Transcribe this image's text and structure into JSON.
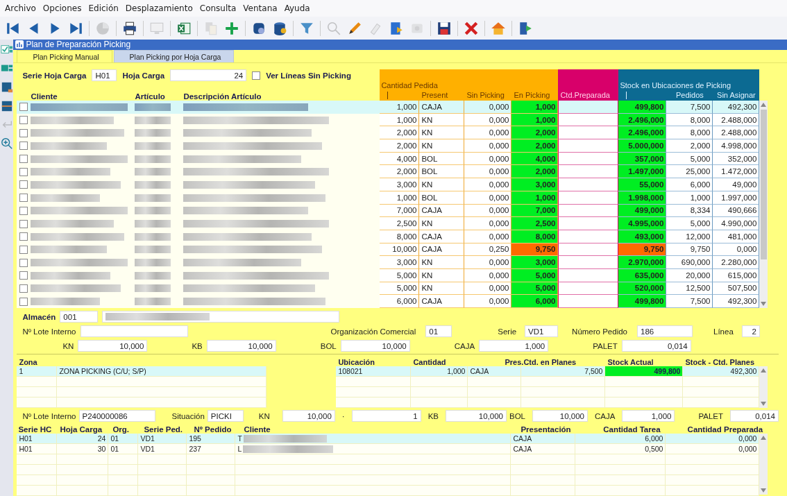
{
  "menu": [
    "Archivo",
    "Opciones",
    "Edición",
    "Desplazamiento",
    "Consulta",
    "Ventana",
    "Ayuda"
  ],
  "toolbar": [
    {
      "kind": "first",
      "disabled": false
    },
    {
      "kind": "prev",
      "disabled": false
    },
    {
      "kind": "next",
      "disabled": false
    },
    {
      "kind": "last",
      "disabled": false
    },
    {
      "kind": "separator"
    },
    {
      "kind": "chart",
      "disabled": true
    },
    {
      "kind": "separator"
    },
    {
      "kind": "print",
      "disabled": false
    },
    {
      "kind": "separator"
    },
    {
      "kind": "monitor",
      "disabled": true
    },
    {
      "kind": "separator"
    },
    {
      "kind": "excel",
      "disabled": false
    },
    {
      "kind": "separator"
    },
    {
      "kind": "copy",
      "disabled": true
    },
    {
      "kind": "add",
      "disabled": false
    },
    {
      "kind": "separator"
    },
    {
      "kind": "database",
      "disabled": false
    },
    {
      "kind": "database-coin",
      "disabled": false
    },
    {
      "kind": "separator"
    },
    {
      "kind": "filter",
      "disabled": false
    },
    {
      "kind": "separator"
    },
    {
      "kind": "search",
      "disabled": true
    },
    {
      "kind": "pencil",
      "disabled": false
    },
    {
      "kind": "eraser",
      "disabled": true
    },
    {
      "kind": "export",
      "disabled": false
    },
    {
      "kind": "help",
      "disabled": true
    },
    {
      "kind": "separator"
    },
    {
      "kind": "save",
      "disabled": false
    },
    {
      "kind": "separator"
    },
    {
      "kind": "delete",
      "disabled": false
    },
    {
      "kind": "separator"
    },
    {
      "kind": "home",
      "disabled": false
    },
    {
      "kind": "separator"
    },
    {
      "kind": "exit",
      "disabled": false
    }
  ],
  "sidebar": [
    {
      "kind": "check",
      "disabled": false
    },
    {
      "kind": "grid",
      "disabled": false
    },
    {
      "kind": "table",
      "disabled": false
    },
    {
      "kind": "rows",
      "disabled": false
    },
    {
      "kind": "return",
      "disabled": true
    },
    {
      "kind": "zoom",
      "disabled": false
    }
  ],
  "window": {
    "title": "Plan de Preparación Picking"
  },
  "tabs": [
    {
      "label": "Plan Picking Manual",
      "selected": true
    },
    {
      "label": "Plan Picking por Hoja Carga",
      "selected": false
    }
  ],
  "filters": {
    "serie_label": "Serie Hoja Carga",
    "serie": "H01",
    "hoja_label": "Hoja Carga",
    "hoja": "24",
    "ver_lineas": {
      "label": "Ver Líneas Sin Picking",
      "checked": false
    }
  },
  "table": {
    "left_columns": [
      "Cliente",
      "Artículo",
      "Descripción Artículo"
    ],
    "group_pedida": "Cantidad Pedida",
    "group_stock": "Stock en Ubicaciones de Picking",
    "columns": [
      "Present",
      "Sin Picking",
      "En Picking",
      "Ctd.Preparada",
      "Pedidos",
      "Sin Asignar"
    ],
    "rows": [
      {
        "selected": true,
        "checked": false,
        "color": "#00ee22",
        "cantidad": "1,000",
        "present": "CAJA",
        "sin_picking": "0,000",
        "en_picking": "1,000",
        "stock": "499,800",
        "pedidos": "7,500",
        "sin_asignar": "492,300"
      },
      {
        "selected": false,
        "checked": false,
        "color": "#00ee22",
        "cantidad": "1,000",
        "present": "KN",
        "sin_picking": "0,000",
        "en_picking": "1,000",
        "stock": "2.496,000",
        "pedidos": "8,000",
        "sin_asignar": "2.488,000"
      },
      {
        "selected": false,
        "checked": false,
        "color": "#00ee22",
        "cantidad": "2,000",
        "present": "KN",
        "sin_picking": "0,000",
        "en_picking": "2,000",
        "stock": "2.496,000",
        "pedidos": "8,000",
        "sin_asignar": "2.488,000"
      },
      {
        "selected": false,
        "checked": false,
        "color": "#00ee22",
        "cantidad": "2,000",
        "present": "KN",
        "sin_picking": "0,000",
        "en_picking": "2,000",
        "stock": "5.000,000",
        "pedidos": "2,000",
        "sin_asignar": "4.998,000"
      },
      {
        "selected": false,
        "checked": false,
        "color": "#00ee22",
        "cantidad": "4,000",
        "present": "BOL",
        "sin_picking": "0,000",
        "en_picking": "4,000",
        "stock": "357,000",
        "pedidos": "5,000",
        "sin_asignar": "352,000"
      },
      {
        "selected": false,
        "checked": false,
        "color": "#00ee22",
        "cantidad": "2,000",
        "present": "BOL",
        "sin_picking": "0,000",
        "en_picking": "2,000",
        "stock": "1.497,000",
        "pedidos": "25,000",
        "sin_asignar": "1.472,000"
      },
      {
        "selected": false,
        "checked": false,
        "color": "#00ee22",
        "cantidad": "3,000",
        "present": "KN",
        "sin_picking": "0,000",
        "en_picking": "3,000",
        "stock": "55,000",
        "pedidos": "6,000",
        "sin_asignar": "49,000"
      },
      {
        "selected": false,
        "checked": false,
        "color": "#00ee22",
        "cantidad": "1,000",
        "present": "BOL",
        "sin_picking": "0,000",
        "en_picking": "1,000",
        "stock": "1.998,000",
        "pedidos": "1,000",
        "sin_asignar": "1.997,000"
      },
      {
        "selected": false,
        "checked": false,
        "color": "#00ee22",
        "cantidad": "7,000",
        "present": "CAJA",
        "sin_picking": "0,000",
        "en_picking": "7,000",
        "stock": "499,000",
        "pedidos": "8,334",
        "sin_asignar": "490,666"
      },
      {
        "selected": false,
        "checked": false,
        "color": "#00ee22",
        "cantidad": "2,500",
        "present": "KN",
        "sin_picking": "0,000",
        "en_picking": "2,500",
        "stock": "4.995,000",
        "pedidos": "5,000",
        "sin_asignar": "4.990,000"
      },
      {
        "selected": false,
        "checked": false,
        "color": "#00ee22",
        "cantidad": "8,000",
        "present": "CAJA",
        "sin_picking": "0,000",
        "en_picking": "8,000",
        "stock": "493,000",
        "pedidos": "12,000",
        "sin_asignar": "481,000"
      },
      {
        "selected": false,
        "checked": false,
        "color": "#ff6a00",
        "cantidad": "10,000",
        "present": "CAJA",
        "sin_picking": "0,250",
        "en_picking": "9,750",
        "stock": "9,750",
        "pedidos": "9,750",
        "sin_asignar": "0,000"
      },
      {
        "selected": false,
        "checked": false,
        "color": "#00ee22",
        "cantidad": "3,000",
        "present": "KN",
        "sin_picking": "0,000",
        "en_picking": "3,000",
        "stock": "2.970,000",
        "pedidos": "690,000",
        "sin_asignar": "2.280,000"
      },
      {
        "selected": false,
        "checked": false,
        "color": "#00ee22",
        "cantidad": "5,000",
        "present": "KN",
        "sin_picking": "0,000",
        "en_picking": "5,000",
        "stock": "635,000",
        "pedidos": "20,000",
        "sin_asignar": "615,000"
      },
      {
        "selected": false,
        "checked": false,
        "color": "#00ee22",
        "cantidad": "5,000",
        "present": "KN",
        "sin_picking": "0,000",
        "en_picking": "5,000",
        "stock": "520,000",
        "pedidos": "12,500",
        "sin_asignar": "507,500"
      },
      {
        "selected": false,
        "checked": false,
        "color": "#00ee22",
        "cantidad": "6,000",
        "present": "CAJA",
        "sin_picking": "0,000",
        "en_picking": "6,000",
        "stock": "499,800",
        "pedidos": "7,500",
        "sin_asignar": "492,300"
      }
    ]
  },
  "detail": {
    "almacen_label": "Almacén",
    "almacen": "001",
    "lote_label": "Nº Lote Interno",
    "org_label": "Organización Comercial",
    "org": "01",
    "serie_label": "Serie",
    "serie": "VD1",
    "pedido_label": "Número Pedido",
    "pedido": "186",
    "linea_label": "Línea",
    "linea": "2",
    "units": [
      {
        "label": "KN",
        "value": "10,000"
      },
      {
        "label": "KB",
        "value": "10,000"
      },
      {
        "label": "BOL",
        "value": "10,000"
      },
      {
        "label": "CAJA",
        "value": "1,000"
      },
      {
        "label": "PALET",
        "value": "0,014"
      }
    ]
  },
  "zona_table": {
    "columns": [
      "Zona",
      "Ubicación",
      "Cantidad",
      "Pres.",
      "Ctd. en Planes",
      "Stock Actual",
      "Stock - Ctd. Planes"
    ],
    "rows": [
      {
        "selected": true,
        "color": "#00ee22",
        "zona": "1",
        "nombre": "ZONA PICKING (C/U; S/P)",
        "ubicacion": "108021",
        "cantidad": "1,000",
        "pres": "CAJA",
        "planes": "7,500",
        "stock": "499,800",
        "resto": "492,300"
      }
    ]
  },
  "lote_line": {
    "lote_label": "Nº Lote Interno",
    "lote": "P240000086",
    "situacion_label": "Situación",
    "situacion": "PICKI",
    "kn_label": "KN",
    "kn": "10,000",
    "dot": "·",
    "count": "1",
    "kb_label": "KB",
    "kb": "10,000",
    "bol_label": "BOL",
    "bol": "10,000",
    "caja_label": "CAJA",
    "caja": "1,000",
    "palet_label": "PALET",
    "palet": "0,014"
  },
  "tasks_table": {
    "columns": [
      "Serie HC",
      "Hoja Carga",
      "Org.",
      "Serie Ped.",
      "Nº Pedido",
      "Cliente",
      "Presentación",
      "Cantidad Tarea",
      "Cantidad Preparada"
    ],
    "rows": [
      {
        "selected": true,
        "serie": "H01",
        "hoja": "24",
        "org": "01",
        "serie_ped": "VD1",
        "pedido": "195",
        "cliente": "T",
        "presentacion": "CAJA",
        "tarea": "6,000",
        "preparada": "0,000"
      },
      {
        "selected": false,
        "serie": "H01",
        "hoja": "30",
        "org": "01",
        "serie_ped": "VD1",
        "pedido": "237",
        "cliente": "L",
        "presentacion": "CAJA",
        "tarea": "0,500",
        "preparada": "0,000"
      }
    ]
  }
}
